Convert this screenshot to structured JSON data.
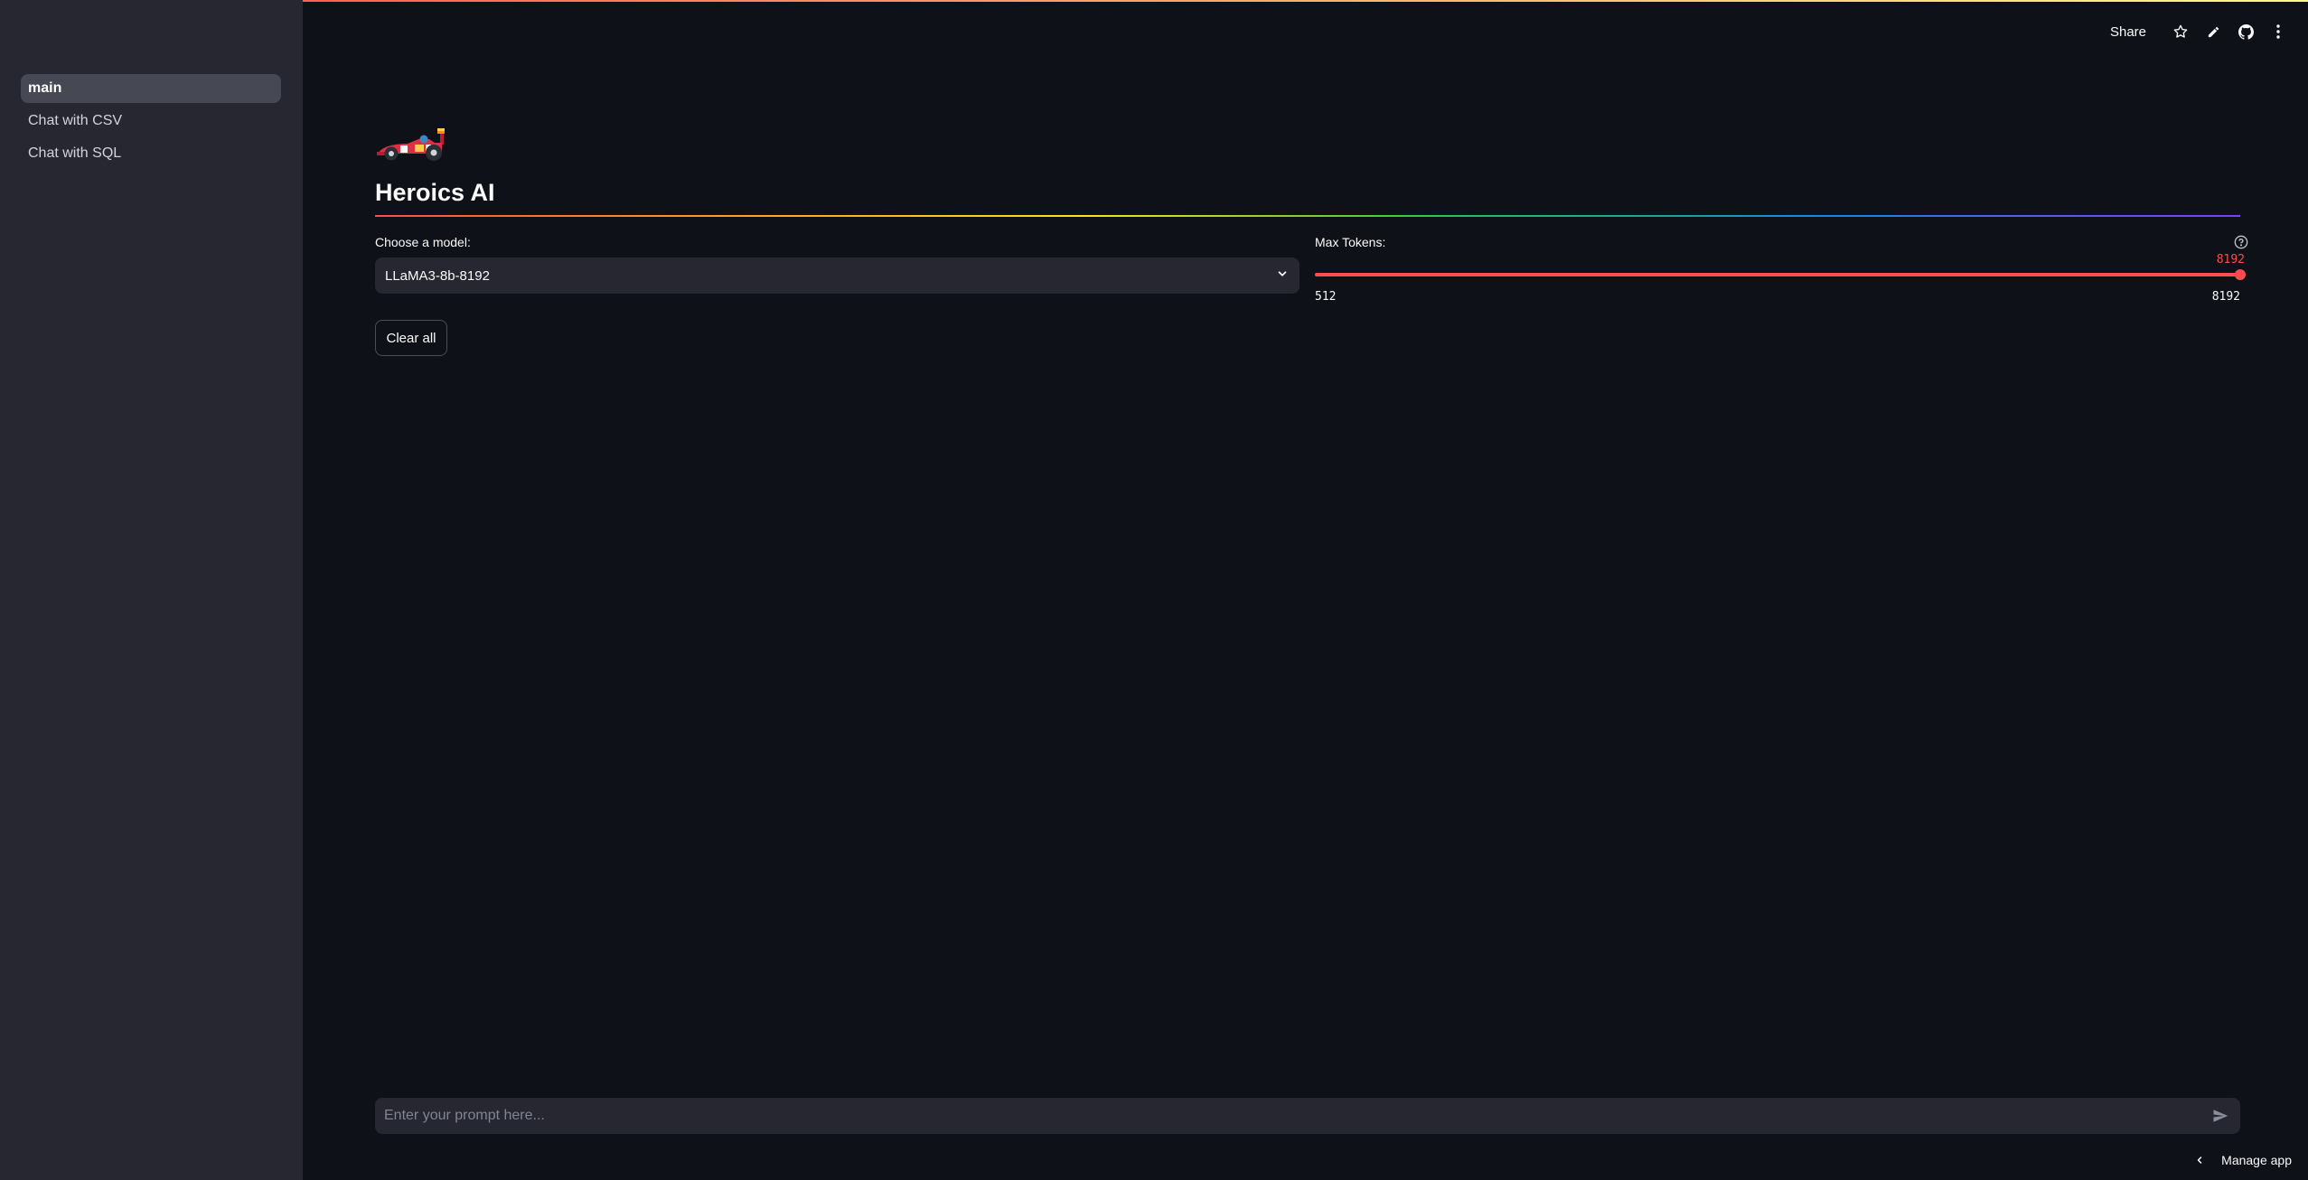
{
  "sidebar": {
    "items": [
      {
        "label": "main",
        "active": true
      },
      {
        "label": "Chat with CSV"
      },
      {
        "label": "Chat with SQL"
      }
    ]
  },
  "header": {
    "share_label": "Share",
    "icons": [
      "star-icon",
      "pencil-icon",
      "github-icon",
      "more-vertical-icon"
    ]
  },
  "main": {
    "logo_icon": "racing-car-icon",
    "title": "Heroics AI",
    "model_select": {
      "label": "Choose a model:",
      "value": "LLaMA3-8b-8192"
    },
    "max_tokens": {
      "label": "Max Tokens:",
      "value": "8192",
      "min": "512",
      "max": "8192",
      "level": 1.0
    },
    "clear_button": "Clear all"
  },
  "chat": {
    "placeholder": "Enter your prompt here..."
  },
  "footer": {
    "manage_app": "Manage app"
  },
  "colors": {
    "accent": "#ff4b4b",
    "background": "#0e1117",
    "sidebar": "#262730"
  }
}
